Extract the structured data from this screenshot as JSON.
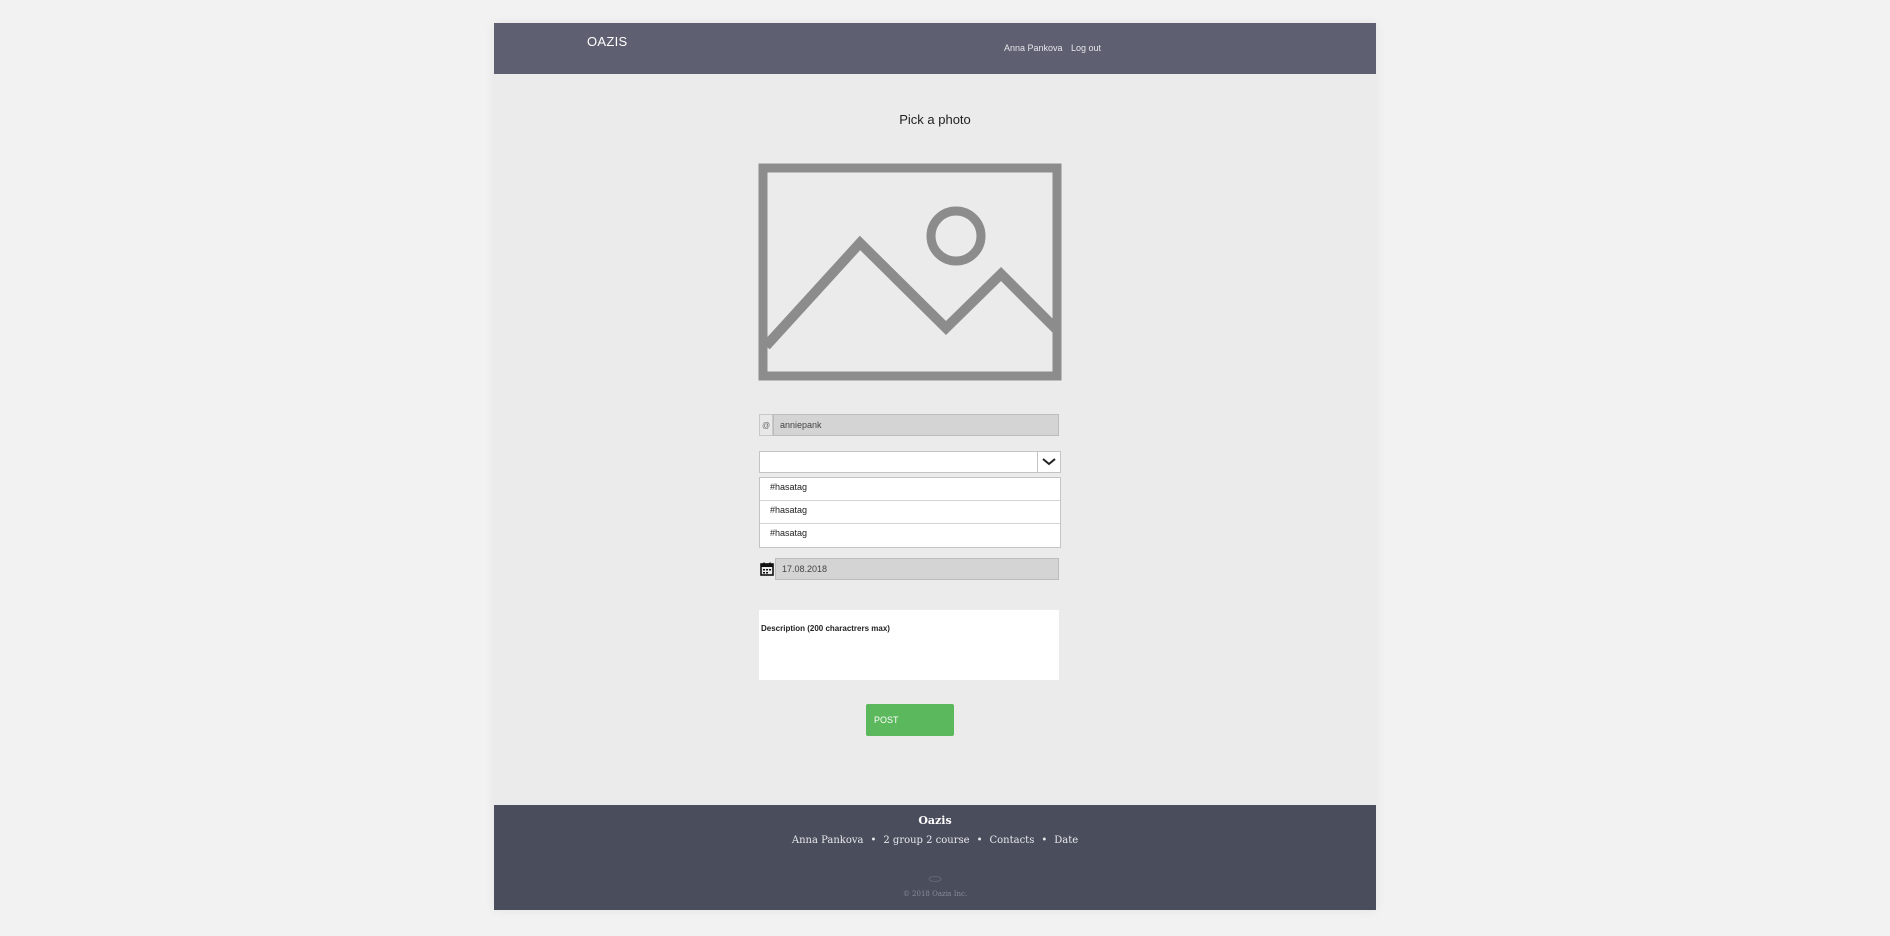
{
  "header": {
    "brand": "OAZIS",
    "nav": {
      "user": "Anna Pankova",
      "logout": "Log out"
    }
  },
  "main": {
    "title": "Pick a photo",
    "image_placeholder_icon": "image-placeholder-icon",
    "username": {
      "prefix": "@",
      "value": "anniepank"
    },
    "hashtag_select": {
      "value": "",
      "icon": "chevron-down-icon"
    },
    "hashtags": [
      "#hasatag",
      "#hasatag",
      "#hasatag"
    ],
    "date": {
      "icon": "calendar-icon",
      "value": "17.08.2018"
    },
    "description_label": "Description (200 charactrers max)",
    "post_button": "POST"
  },
  "footer": {
    "title": "Oazis",
    "links": [
      "Anna Pankova",
      "2 group 2 course",
      "Contacts",
      "Date"
    ],
    "separator": "•",
    "copyright": "© 2018 Oazis Inc."
  },
  "colors": {
    "header_bg": "#5e6071",
    "footer_bg": "#4a4d5b",
    "page_bg": "#ebebeb",
    "post_button": "#5cb85c",
    "placeholder_stroke": "#8c8c8c"
  }
}
